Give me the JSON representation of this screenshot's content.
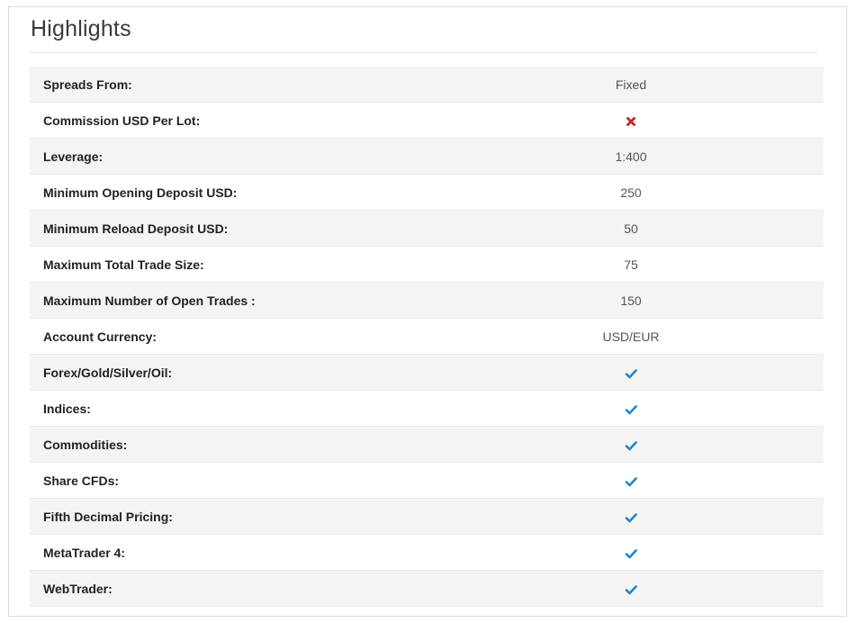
{
  "title": "Highlights",
  "colors": {
    "check": "#1e86c8",
    "cross": "#cc1f1f"
  },
  "rows": [
    {
      "label": "Spreads From:",
      "value": "Fixed",
      "icon": null
    },
    {
      "label": "Commission USD Per Lot:",
      "value": "",
      "icon": "cross-icon"
    },
    {
      "label": "Leverage:",
      "value": "1:400",
      "icon": null
    },
    {
      "label": "Minimum Opening Deposit USD:",
      "value": "250",
      "icon": null
    },
    {
      "label": "Minimum Reload Deposit USD:",
      "value": "50",
      "icon": null
    },
    {
      "label": "Maximum Total Trade Size:",
      "value": "75",
      "icon": null
    },
    {
      "label": "Maximum Number of Open Trades :",
      "value": "150",
      "icon": null
    },
    {
      "label": "Account Currency:",
      "value": "USD/EUR",
      "icon": null
    },
    {
      "label": "Forex/Gold/Silver/Oil:",
      "value": "",
      "icon": "checkmark-icon"
    },
    {
      "label": "Indices:",
      "value": "",
      "icon": "checkmark-icon"
    },
    {
      "label": "Commodities:",
      "value": "",
      "icon": "checkmark-icon"
    },
    {
      "label": "Share CFDs:",
      "value": "",
      "icon": "checkmark-icon"
    },
    {
      "label": "Fifth Decimal Pricing:",
      "value": "",
      "icon": "checkmark-icon"
    },
    {
      "label": "MetaTrader 4:",
      "value": "",
      "icon": "checkmark-icon"
    },
    {
      "label": "WebTrader:",
      "value": "",
      "icon": "checkmark-icon"
    }
  ]
}
